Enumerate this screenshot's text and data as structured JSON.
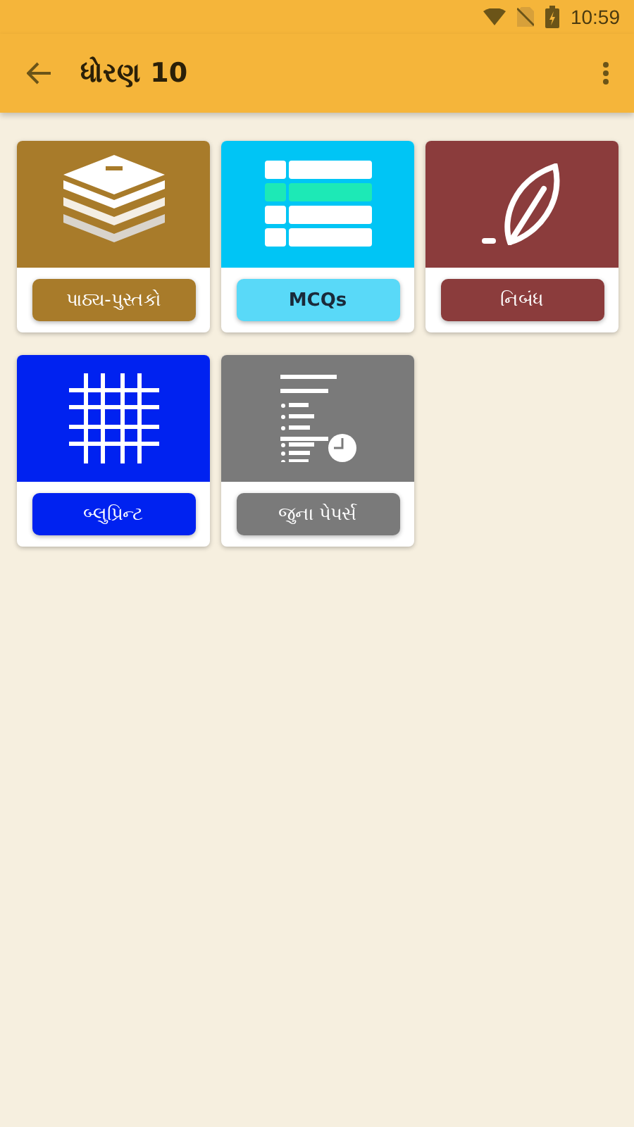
{
  "status_bar": {
    "time": "10:59"
  },
  "app_bar": {
    "title": "ધોરણ 10"
  },
  "tiles": [
    {
      "label": "પાઠ્ય-પુસ્તકો",
      "kind": "books",
      "color": "#a87b2a"
    },
    {
      "label": "MCQs",
      "kind": "list",
      "color": "#00c5f5"
    },
    {
      "label": "નિબંધ",
      "kind": "quill",
      "color": "#8b3c3c"
    },
    {
      "label": "બ્લુપ્રિન્ટ",
      "kind": "grid",
      "color": "#0022f0"
    },
    {
      "label": "જુના પેપર્સ",
      "kind": "papers",
      "color": "#7a7a7a"
    }
  ]
}
